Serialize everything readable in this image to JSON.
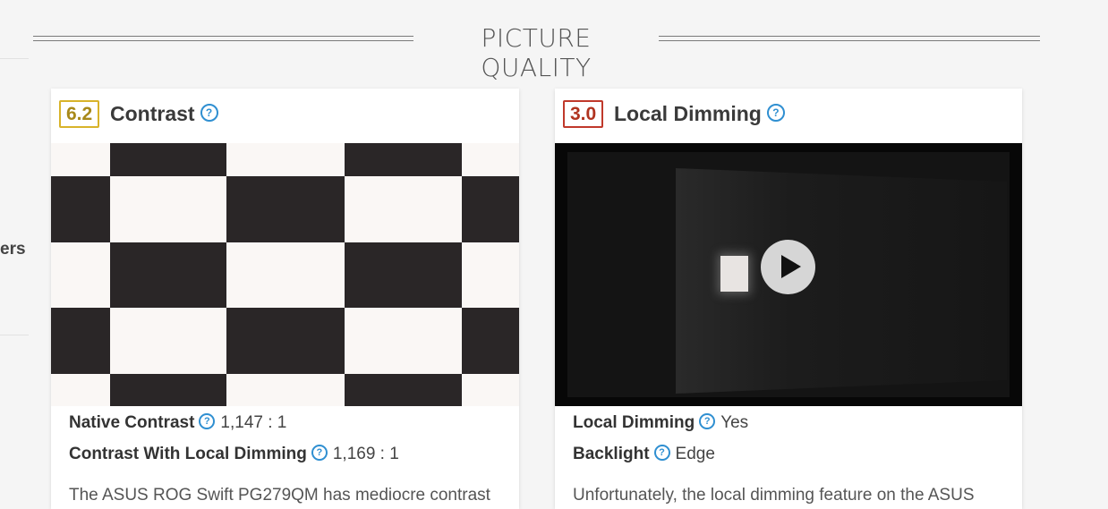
{
  "sidebar": {
    "fragment_label": "ers"
  },
  "section": {
    "title": "PICTURE QUALITY"
  },
  "cards": [
    {
      "score": "6.2",
      "title": "Contrast",
      "help_icon": "question-circle-icon",
      "media": "checkerboard contrast test image",
      "specs": [
        {
          "label": "Native Contrast",
          "value": "1,147 : 1"
        },
        {
          "label": "Contrast With Local Dimming",
          "value": "1,169 : 1"
        }
      ],
      "description": "The ASUS ROG Swift PG279QM has mediocre contrast"
    },
    {
      "score": "3.0",
      "title": "Local Dimming",
      "help_icon": "question-circle-icon",
      "media": "local dimming test video",
      "play_icon": "play-icon",
      "specs": [
        {
          "label": "Local Dimming",
          "value": "Yes"
        },
        {
          "label": "Backlight",
          "value": "Edge"
        }
      ],
      "description": "Unfortunately, the local dimming feature on the ASUS"
    }
  ],
  "colors": {
    "score_mid": "#d8b32a",
    "score_low": "#c0392b",
    "help_icon": "#2f8fd1"
  }
}
